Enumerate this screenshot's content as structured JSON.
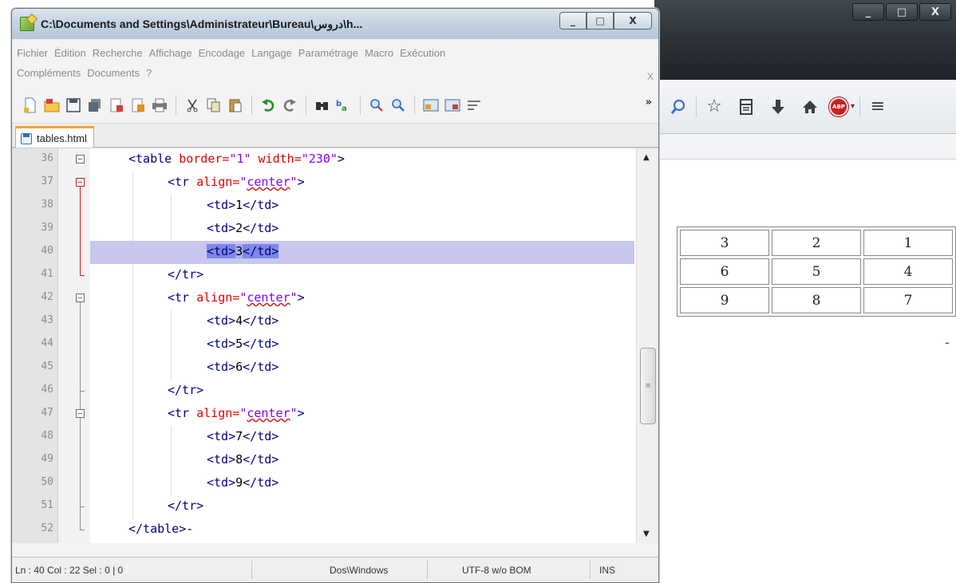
{
  "notepad": {
    "title": "C:\\Documents and Settings\\Administrateur\\Bureau\\دروس\\h...",
    "window_buttons": {
      "minimize": "_",
      "maximize": "□",
      "close": "X"
    },
    "menu_row1": [
      "Fichier",
      "Édition",
      "Recherche",
      "Affichage",
      "Encodage",
      "Langage",
      "Paramétrage",
      "Macro",
      "Exécution"
    ],
    "menu_row2": [
      "Compléments",
      "Documents",
      "?"
    ],
    "menu_close": "X",
    "toolbar_overflow": "»",
    "tab": {
      "label": "tables.html"
    },
    "lines": [
      {
        "n": "36",
        "indent": 0
      },
      {
        "n": "37",
        "indent": 1
      },
      {
        "n": "38",
        "indent": 2
      },
      {
        "n": "39",
        "indent": 2
      },
      {
        "n": "40",
        "indent": 2
      },
      {
        "n": "41",
        "indent": 1
      },
      {
        "n": "42",
        "indent": 1
      },
      {
        "n": "43",
        "indent": 2
      },
      {
        "n": "44",
        "indent": 2
      },
      {
        "n": "45",
        "indent": 2
      },
      {
        "n": "46",
        "indent": 1
      },
      {
        "n": "47",
        "indent": 1
      },
      {
        "n": "48",
        "indent": 2
      },
      {
        "n": "49",
        "indent": 2
      },
      {
        "n": "50",
        "indent": 2
      },
      {
        "n": "51",
        "indent": 1
      },
      {
        "n": "52",
        "indent": 0
      }
    ],
    "code": {
      "table_open": {
        "tag": "<table",
        "attr1": " border=",
        "val1": "\"1\"",
        "attr2": " width=",
        "val2": "\"230\"",
        "close": ">"
      },
      "tr_open": {
        "tag": "<tr",
        "attr": " align=",
        "q1": "\"",
        "val": "center",
        "q2": "\"",
        "close": ">"
      },
      "td_open": "<td>",
      "td_close": "</td>",
      "tr_close": "</tr>",
      "table_close": "</table>",
      "table_close_suffix": "-",
      "cell_values": [
        "1",
        "2",
        "3",
        "4",
        "5",
        "6",
        "7",
        "8",
        "9"
      ]
    },
    "scrollbar": {
      "up": "▲",
      "down": "▼",
      "grip": "≡"
    },
    "status": {
      "position": "Ln : 40    Col : 22    Sel : 0 | 0",
      "eol": "Dos\\Windows",
      "encoding": "UTF-8 w/o BOM",
      "mode": "INS"
    }
  },
  "browser": {
    "window_buttons": {
      "minimize": "_",
      "maximize": "□",
      "close": "X"
    },
    "toolbar_icons": [
      "search-icon",
      "star-icon",
      "reading-list-icon",
      "download-icon",
      "home-icon",
      "adblock-icon",
      "menu-icon"
    ],
    "adblock_label": "ABP",
    "table_rows": [
      [
        "3",
        "2",
        "1"
      ],
      [
        "6",
        "5",
        "4"
      ],
      [
        "9",
        "8",
        "7"
      ]
    ],
    "trailing_text": "-"
  }
}
